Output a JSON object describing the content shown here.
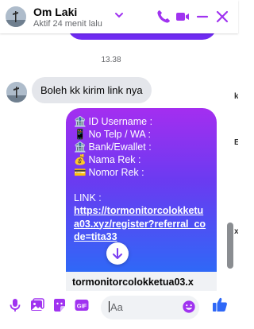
{
  "header": {
    "name": "Om Laki",
    "status": "Aktif 24 menit lalu"
  },
  "colors": {
    "accent": "#a033f0",
    "accent_blue": "#2f68f7",
    "incoming_bubble": "#e4e6eb"
  },
  "chat": {
    "timestamp": "13.38",
    "incoming_message": "Boleh kk kirim link nya",
    "outgoing": {
      "lines": [
        {
          "icon": "bank-icon",
          "emoji": "🏦",
          "text": " ID Username :"
        },
        {
          "icon": "phone-icon",
          "emoji": "📱",
          "text": " No Telp / WA :"
        },
        {
          "icon": "bank-icon",
          "emoji": "🏦",
          "text": " Bank/Ewallet :"
        },
        {
          "icon": "money-bag-icon",
          "emoji": "💰",
          "text": " Nama Rek      :"
        },
        {
          "icon": "card-icon",
          "emoji": "💳",
          "text": "  Nomor Rek   :"
        }
      ],
      "link_label": "LINK :",
      "link_url": "https://tormonitorcolokketua03.xyz/register?referral_code=tita33"
    },
    "preview_title": "tormonitorcolokketua03.x",
    "edge_texts": [
      "k",
      "E",
      "x"
    ]
  },
  "composer": {
    "placeholder": "Aa"
  }
}
